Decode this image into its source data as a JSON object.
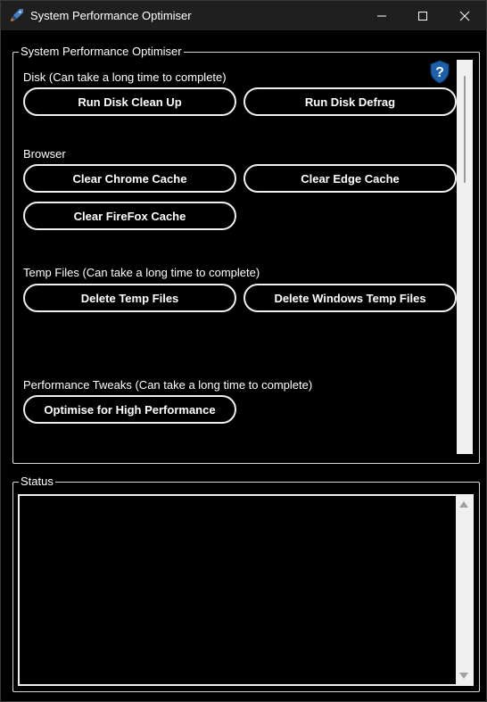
{
  "window": {
    "title": "System Performance Optimiser",
    "icon": "rocket-app-icon"
  },
  "main_group": {
    "legend": "System Performance Optimiser",
    "help_icon": "question-shield-icon",
    "sections": {
      "disk": {
        "label": "Disk (Can take a long time to complete)",
        "buttons": [
          "Run Disk Clean Up",
          "Run Disk Defrag"
        ]
      },
      "browser": {
        "label": "Browser",
        "buttons": [
          "Clear Chrome Cache",
          "Clear Edge Cache",
          "Clear FireFox Cache"
        ]
      },
      "temp": {
        "label": "Temp Files (Can take a long time to complete)",
        "buttons": [
          "Delete Temp Files",
          "Delete Windows Temp Files"
        ]
      },
      "tweaks": {
        "label": "Performance Tweaks (Can take a long time to complete)",
        "buttons": [
          "Optimise for High Performance"
        ]
      }
    }
  },
  "status_group": {
    "legend": "Status",
    "text": ""
  },
  "colors": {
    "background": "#000000",
    "titlebar": "#1f1f1f",
    "border": "#f0f0f0",
    "help_icon": "#1e5fa8"
  }
}
